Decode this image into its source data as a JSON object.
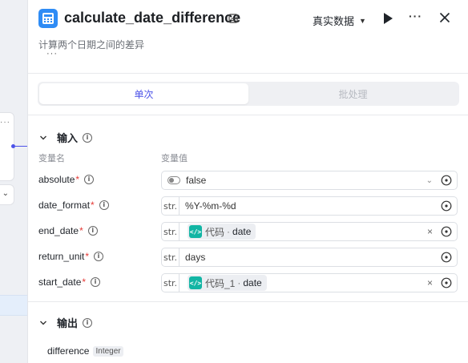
{
  "header": {
    "title": "calculate_date_difference",
    "description": "计算两个日期之间的差异",
    "description_more": "···",
    "data_select_label": "真实数据",
    "app_icon": "calculator-icon",
    "accent": "#4d53e8"
  },
  "tabs": [
    {
      "label": "单次",
      "active": true
    },
    {
      "label": "批处理",
      "active": false
    }
  ],
  "input_section": {
    "title": "输入",
    "col_name": "变量名",
    "col_value": "变量值",
    "rows": [
      {
        "name": "absolute",
        "required": "*",
        "type": "toggle",
        "value": "false"
      },
      {
        "name": "date_format",
        "required": "*",
        "prefix": "str.",
        "value": "%Y-%m-%d"
      },
      {
        "name": "end_date",
        "required": "*",
        "prefix": "str.",
        "ref_node": "代码",
        "ref_sep": "·",
        "ref_var": "date",
        "clear": "×"
      },
      {
        "name": "return_unit",
        "required": "*",
        "prefix": "str.",
        "value": "days"
      },
      {
        "name": "start_date",
        "required": "*",
        "prefix": "str.",
        "ref_node": "代码_1",
        "ref_sep": "·",
        "ref_var": "date",
        "clear": "×"
      }
    ]
  },
  "output_section": {
    "title": "输出",
    "rows": [
      {
        "name": "difference",
        "type": "Integer"
      }
    ]
  },
  "canvas": {
    "card_menu": "···"
  }
}
